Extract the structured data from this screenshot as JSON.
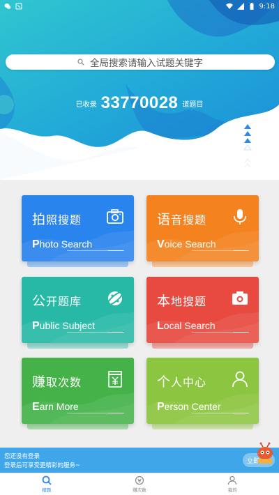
{
  "status_bar": {
    "time": "9:18",
    "icons_left": [
      "wechat-icon",
      "notification-icon"
    ],
    "icons_right": [
      "wifi-icon",
      "signal-icon",
      "battery-icon"
    ]
  },
  "search": {
    "placeholder": "全局搜索请输入试题关键字"
  },
  "counter": {
    "prefix": "已收录",
    "value": "33770028",
    "suffix": "道题目"
  },
  "cards": [
    {
      "title_first": "拍",
      "title_rest": "照搜题",
      "sub_cap": "P",
      "sub_rest": "hoto Search",
      "icon": "camera-outline-icon",
      "color": "#2a84ee",
      "under": "#9fc8f5"
    },
    {
      "title_first": "语",
      "title_rest": "音搜题",
      "sub_cap": "V",
      "sub_rest": "oice Search",
      "icon": "microphone-icon",
      "color": "#f4821e",
      "under": "#f9c596"
    },
    {
      "title_first": "公",
      "title_rest": "开题库",
      "sub_cap": "P",
      "sub_rest": "ublic Subject",
      "icon": "planet-icon",
      "color": "#27b9a6",
      "under": "#9bdcd2"
    },
    {
      "title_first": "本",
      "title_rest": "地搜题",
      "sub_cap": "L",
      "sub_rest": "ocal Search",
      "icon": "camera-filled-icon",
      "color": "#e84a3f",
      "under": "#f3a8a2"
    },
    {
      "title_first": "赚",
      "title_rest": "取次数",
      "sub_cap": "E",
      "sub_rest": "arn More",
      "icon": "yuan-jar-icon",
      "color": "#45b249",
      "under": "#a8dba9"
    },
    {
      "title_first": "个",
      "title_rest": "人中心",
      "sub_cap": "P",
      "sub_rest": "erson Center",
      "icon": "person-icon",
      "color": "#8cc53f",
      "under": "#cbe5a4"
    }
  ],
  "login_banner": {
    "line1": "您还没有登录",
    "line2": "登录后可享受更精彩的服务~",
    "button": "立即"
  },
  "bottom_nav": [
    {
      "label": "搜题",
      "icon": "search-icon",
      "active": true
    },
    {
      "label": "赚次数",
      "icon": "coin-icon",
      "active": false
    },
    {
      "label": "我的",
      "icon": "user-icon",
      "active": false
    }
  ],
  "colors": {
    "accent": "#2c8ae6",
    "hero_top": "#2ec1ce",
    "hero_bottom": "#1a92d6"
  }
}
